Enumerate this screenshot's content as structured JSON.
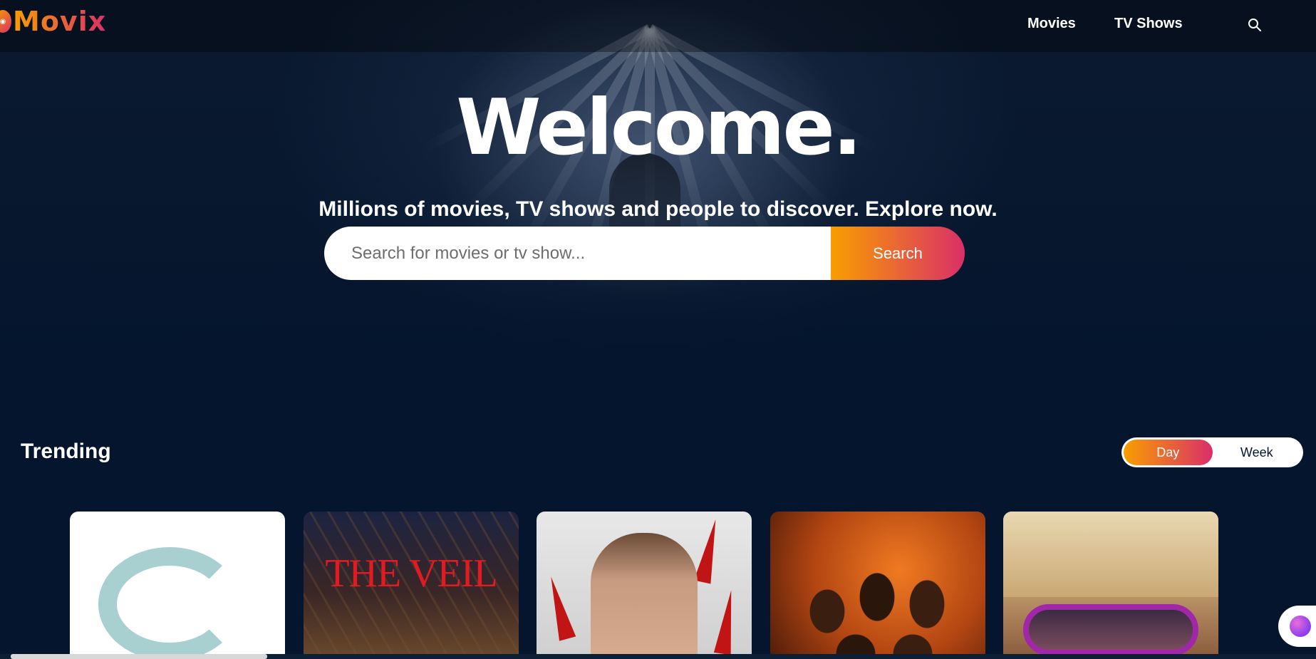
{
  "app": {
    "logo_text": "Movix",
    "accent_start": "#f89e00",
    "accent_end": "#da2f68",
    "background": "#04152d"
  },
  "header": {
    "nav": [
      {
        "label": "Movies"
      },
      {
        "label": "TV Shows"
      }
    ],
    "search_icon": "search-icon"
  },
  "hero": {
    "title": "Welcome.",
    "subtitle": "Millions of movies, TV shows and people to discover. Explore now.",
    "search_placeholder": "Search for movies or tv show...",
    "search_button": "Search"
  },
  "trending": {
    "title": "Trending",
    "tabs": [
      {
        "label": "Day",
        "active": true
      },
      {
        "label": "Week",
        "active": false
      }
    ],
    "cards": [
      {
        "poster_text": ""
      },
      {
        "poster_text": "THE VEIL"
      },
      {
        "poster_text": ""
      },
      {
        "poster_text": ""
      },
      {
        "poster_text": ""
      }
    ]
  },
  "widget": {
    "icon": "brain-icon"
  }
}
